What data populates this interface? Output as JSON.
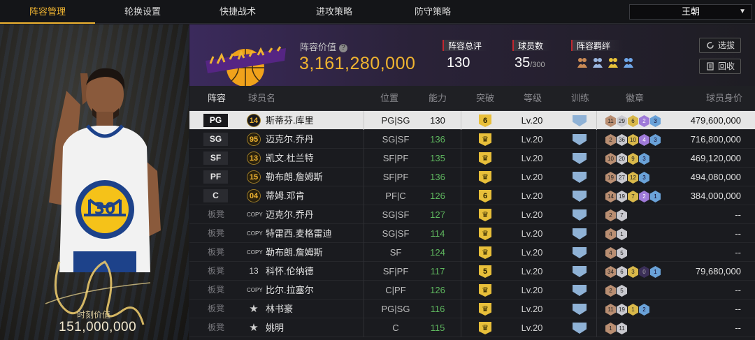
{
  "nav": {
    "tabs": [
      "阵容管理",
      "轮换设置",
      "快捷战术",
      "进攻策略",
      "防守策略"
    ],
    "active": 0,
    "team_select": "王朝"
  },
  "card": {
    "moment_label": "时刻价值",
    "moment_value": "151,000,000"
  },
  "team": {
    "value_label": "阵容价值",
    "value": "3,161,280,000",
    "overall_label": "阵容总评",
    "overall": "130",
    "count_label": "球员数",
    "count": "35",
    "count_max": "/300",
    "bond_label": "阵容羁绊",
    "btn_select": "选拔",
    "btn_recycle": "回收"
  },
  "table": {
    "headers": [
      "阵容",
      "球员名",
      "位置",
      "能力",
      "突破",
      "等级",
      "训练",
      "徽章",
      "球员身价"
    ],
    "rows": [
      {
        "slot": "PG",
        "num": "14",
        "num_style": "ring",
        "name": "斯蒂芬.库里",
        "pos": "PG|SG",
        "ovr": "130",
        "break": "6",
        "lv": "Lv.20",
        "badges": [
          [
            "11",
            "br"
          ],
          [
            "29",
            "si"
          ],
          [
            "6",
            "go"
          ],
          [
            "2",
            "pu"
          ],
          [
            "3",
            "bl"
          ]
        ],
        "value": "479,600,000",
        "selected": true
      },
      {
        "slot": "SG",
        "num": "95",
        "num_style": "ring",
        "name": "迈克尔.乔丹",
        "pos": "SG|SF",
        "ovr": "136",
        "break": "crown",
        "lv": "Lv.20",
        "badges": [
          [
            "2",
            "br"
          ],
          [
            "36",
            "si"
          ],
          [
            "10",
            "go"
          ],
          [
            "4",
            "pu"
          ],
          [
            "3",
            "bl"
          ]
        ],
        "value": "716,800,000"
      },
      {
        "slot": "SF",
        "num": "13",
        "num_style": "ring",
        "name": "凯文.杜兰特",
        "pos": "SF|PF",
        "ovr": "135",
        "break": "crown",
        "lv": "Lv.20",
        "badges": [
          [
            "10",
            "br"
          ],
          [
            "20",
            "si"
          ],
          [
            "9",
            "go"
          ],
          [
            "3",
            "bl"
          ]
        ],
        "value": "469,120,000"
      },
      {
        "slot": "PF",
        "num": "15",
        "num_style": "ring",
        "name": "勒布朗.詹姆斯",
        "pos": "SF|PF",
        "ovr": "136",
        "break": "crown",
        "lv": "Lv.20",
        "badges": [
          [
            "19",
            "br"
          ],
          [
            "27",
            "si"
          ],
          [
            "12",
            "go"
          ],
          [
            "3",
            "bl"
          ]
        ],
        "value": "494,080,000"
      },
      {
        "slot": "C",
        "num": "04",
        "num_style": "ring",
        "name": "蒂姆.邓肯",
        "pos": "PF|C",
        "ovr": "126",
        "break": "6",
        "lv": "Lv.20",
        "badges": [
          [
            "14",
            "br"
          ],
          [
            "19",
            "si"
          ],
          [
            "7",
            "go"
          ],
          [
            "2",
            "pu"
          ],
          [
            "1",
            "bl"
          ]
        ],
        "value": "384,000,000"
      },
      {
        "slot": "板凳",
        "num": "COPY",
        "num_style": "copy",
        "name": "迈克尔.乔丹",
        "pos": "SG|SF",
        "ovr": "127",
        "break": "crown",
        "lv": "Lv.20",
        "badges": [
          [
            "2",
            "br"
          ],
          [
            "7",
            "si"
          ]
        ],
        "value": "--"
      },
      {
        "slot": "板凳",
        "num": "COPY",
        "num_style": "copy",
        "name": "特雷西.麦格雷迪",
        "pos": "SG|SF",
        "ovr": "114",
        "break": "crown",
        "lv": "Lv.20",
        "badges": [
          [
            "4",
            "br"
          ],
          [
            "1",
            "si"
          ]
        ],
        "value": "--"
      },
      {
        "slot": "板凳",
        "num": "COPY",
        "num_style": "copy",
        "name": "勒布朗.詹姆斯",
        "pos": "SF",
        "ovr": "124",
        "break": "crown",
        "lv": "Lv.20",
        "badges": [
          [
            "4",
            "br"
          ],
          [
            "5",
            "si"
          ]
        ],
        "value": "--"
      },
      {
        "slot": "板凳",
        "num": "13",
        "num_style": "plain",
        "name": "科怀.伦纳德",
        "pos": "SF|PF",
        "ovr": "117",
        "break": "5",
        "lv": "Lv.20",
        "badges": [
          [
            "34",
            "br"
          ],
          [
            "6",
            "si"
          ],
          [
            "3",
            "go"
          ],
          [
            "0",
            "dk"
          ],
          [
            "1",
            "bl"
          ]
        ],
        "value": "79,680,000"
      },
      {
        "slot": "板凳",
        "num": "COPY",
        "num_style": "copy",
        "name": "比尔.拉塞尔",
        "pos": "C|PF",
        "ovr": "126",
        "break": "crown",
        "lv": "Lv.20",
        "badges": [
          [
            "2",
            "br"
          ],
          [
            "5",
            "si"
          ]
        ],
        "value": "--"
      },
      {
        "slot": "板凳",
        "num": "★",
        "num_style": "star",
        "name": "林书豪",
        "pos": "PG|SG",
        "ovr": "116",
        "break": "crown",
        "lv": "Lv.20",
        "badges": [
          [
            "11",
            "br"
          ],
          [
            "19",
            "si"
          ],
          [
            "1",
            "go"
          ],
          [
            "2",
            "bl"
          ]
        ],
        "value": "--"
      },
      {
        "slot": "板凳",
        "num": "★",
        "num_style": "star",
        "name": "姚明",
        "pos": "C",
        "ovr": "115",
        "break": "crown",
        "lv": "Lv.20",
        "badges": [
          [
            "1",
            "br"
          ],
          [
            "11",
            "si"
          ]
        ],
        "value": "--"
      }
    ]
  },
  "icons": {
    "help": "question-icon",
    "dropdown": "chevron-down-icon",
    "select": "refresh-icon",
    "recycle": "recycle-icon",
    "break_crown": "crown-icon",
    "train": "shield-icon"
  },
  "colors": {
    "accent": "#f0b430",
    "lakers_purple": "#552583",
    "green": "#5fb85f"
  }
}
